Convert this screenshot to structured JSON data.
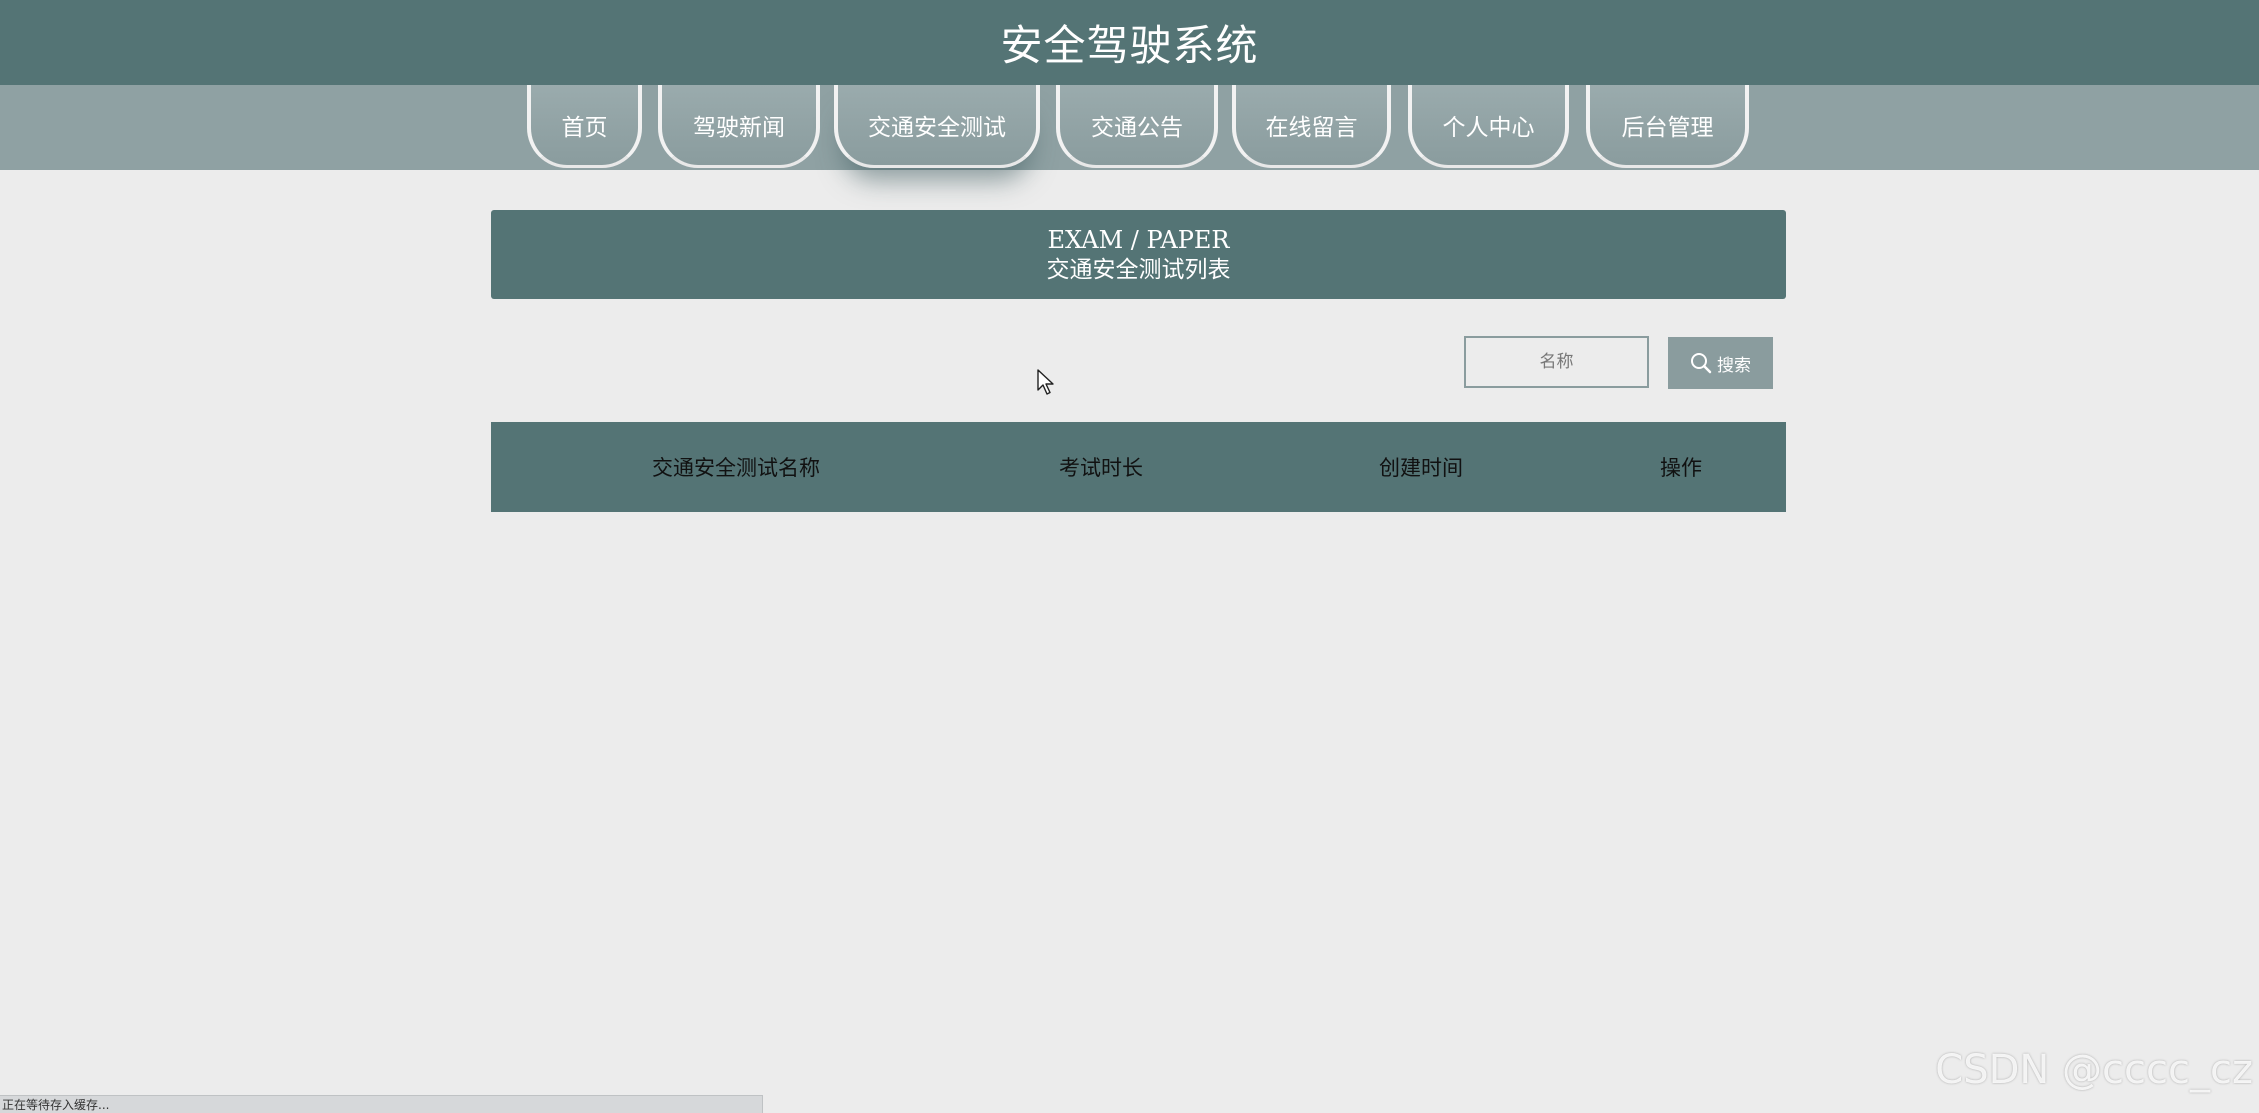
{
  "header": {
    "title": "安全驾驶系统"
  },
  "nav": {
    "items": [
      {
        "label": "首页"
      },
      {
        "label": "驾驶新闻"
      },
      {
        "label": "交通安全测试"
      },
      {
        "label": "交通公告"
      },
      {
        "label": "在线留言"
      },
      {
        "label": "个人中心"
      },
      {
        "label": "后台管理"
      }
    ],
    "active": "交通安全测试"
  },
  "banner": {
    "en": "EXAM / PAPER",
    "cn": "交通安全测试列表"
  },
  "search": {
    "placeholder": "名称",
    "button_label": "搜索",
    "button_icon": "search-icon"
  },
  "table": {
    "columns": [
      "交通安全测试名称",
      "考试时长",
      "创建时间",
      "操作"
    ],
    "rows": []
  },
  "statusbar": {
    "text": "正在等待存入缓存..."
  },
  "watermark": "CSDN @cccc_cz",
  "colors": {
    "primary": "#547475",
    "nav_bg": "#8fa1a3",
    "button": "#8a9c9e",
    "page_bg": "#ececec"
  }
}
